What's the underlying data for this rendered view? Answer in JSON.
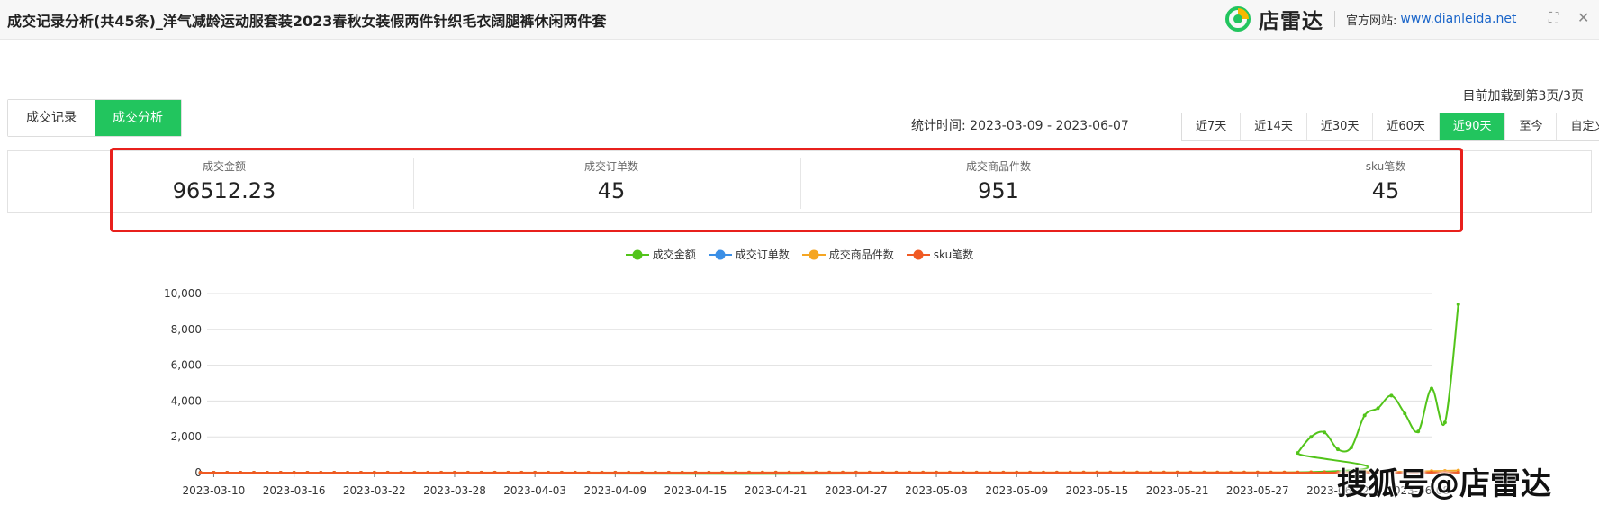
{
  "window": {
    "title": "成交记录分析(共45条)_洋气减龄运动服套装2023春秋女装假两件针织毛衣阔腿裤休闲两件套",
    "brand": "店雷达",
    "site_label": "官方网站:",
    "site_url": "www.dianleida.net"
  },
  "pages_status": "目前加载到第3页/3页",
  "tabs": [
    {
      "label": "成交记录",
      "active": false
    },
    {
      "label": "成交分析",
      "active": true
    }
  ],
  "stat_time": "统计时间: 2023-03-09 - 2023-06-07",
  "ranges": [
    {
      "label": "近7天",
      "active": false
    },
    {
      "label": "近14天",
      "active": false
    },
    {
      "label": "近30天",
      "active": false
    },
    {
      "label": "近60天",
      "active": false
    },
    {
      "label": "近90天",
      "active": true
    },
    {
      "label": "至今",
      "active": false
    },
    {
      "label": "自定义",
      "active": false
    }
  ],
  "summary": [
    {
      "label": "成交金额",
      "value": "96512.23"
    },
    {
      "label": "成交订单数",
      "value": "45"
    },
    {
      "label": "成交商品件数",
      "value": "951"
    },
    {
      "label": "sku笔数",
      "value": "45"
    }
  ],
  "watermark": "搜狐号@店雷达",
  "colors": {
    "accent": "#22c55e",
    "highlight": "#e8201c",
    "series_amount": "#52c41a",
    "series_orders": "#3b8fe6",
    "series_items": "#f5a623",
    "series_sku": "#f05a23"
  },
  "chart_data": {
    "type": "line",
    "x_tick_labels": [
      "2023-03-10",
      "2023-03-16",
      "2023-03-22",
      "2023-03-28",
      "2023-04-03",
      "2023-04-09",
      "2023-04-15",
      "2023-04-21",
      "2023-04-27",
      "2023-05-03",
      "2023-05-09",
      "2023-05-15",
      "2023-05-21",
      "2023-05-27",
      "2023-06-02",
      "2023-06-08"
    ],
    "ylim": [
      0,
      10000
    ],
    "y_ticks": [
      "0",
      "2,000",
      "4,000",
      "6,000",
      "8,000",
      "10,000"
    ],
    "y_tick_values": [
      0,
      2000,
      4000,
      6000,
      8000,
      10000
    ],
    "grid": true,
    "legend_position": "top-center",
    "x_start": "2023-03-09",
    "x_end": "2023-06-07",
    "series": [
      {
        "name": "成交金额",
        "color": "#52c41a",
        "smooth": true,
        "points": [
          [
            "2023-03-09",
            0
          ],
          [
            "2023-05-29",
            0
          ],
          [
            "2023-05-30",
            1100
          ],
          [
            "2023-05-31",
            2000
          ],
          [
            "2023-06-01",
            2250
          ],
          [
            "2023-06-02",
            1300
          ],
          [
            "2023-06-03",
            1400
          ],
          [
            "2023-06-04",
            3200
          ],
          [
            "2023-06-05",
            3600
          ],
          [
            "2023-06-06",
            4300
          ],
          [
            "2023-06-07",
            3300
          ],
          [
            "2023-06-08",
            2300
          ],
          [
            "2023-06-09",
            4700
          ],
          [
            "2023-06-10",
            2800
          ],
          [
            "2023-06-11",
            9400
          ]
        ]
      },
      {
        "name": "成交订单数",
        "color": "#3b8fe6",
        "smooth": false,
        "points": [
          [
            "2023-03-09",
            0
          ],
          [
            "2023-05-30",
            2
          ],
          [
            "2023-06-01",
            3
          ],
          [
            "2023-06-04",
            4
          ],
          [
            "2023-06-07",
            4
          ],
          [
            "2023-06-11",
            6
          ]
        ]
      },
      {
        "name": "成交商品件数",
        "color": "#f5a623",
        "smooth": false,
        "points": [
          [
            "2023-03-09",
            0
          ],
          [
            "2023-05-30",
            20
          ],
          [
            "2023-06-01",
            40
          ],
          [
            "2023-06-04",
            60
          ],
          [
            "2023-06-07",
            50
          ],
          [
            "2023-06-11",
            120
          ]
        ]
      },
      {
        "name": "sku笔数",
        "color": "#f05a23",
        "smooth": false,
        "points": [
          [
            "2023-03-09",
            0
          ],
          [
            "2023-05-30",
            2
          ],
          [
            "2023-06-01",
            3
          ],
          [
            "2023-06-04",
            4
          ],
          [
            "2023-06-07",
            4
          ],
          [
            "2023-06-11",
            6
          ]
        ]
      }
    ]
  }
}
